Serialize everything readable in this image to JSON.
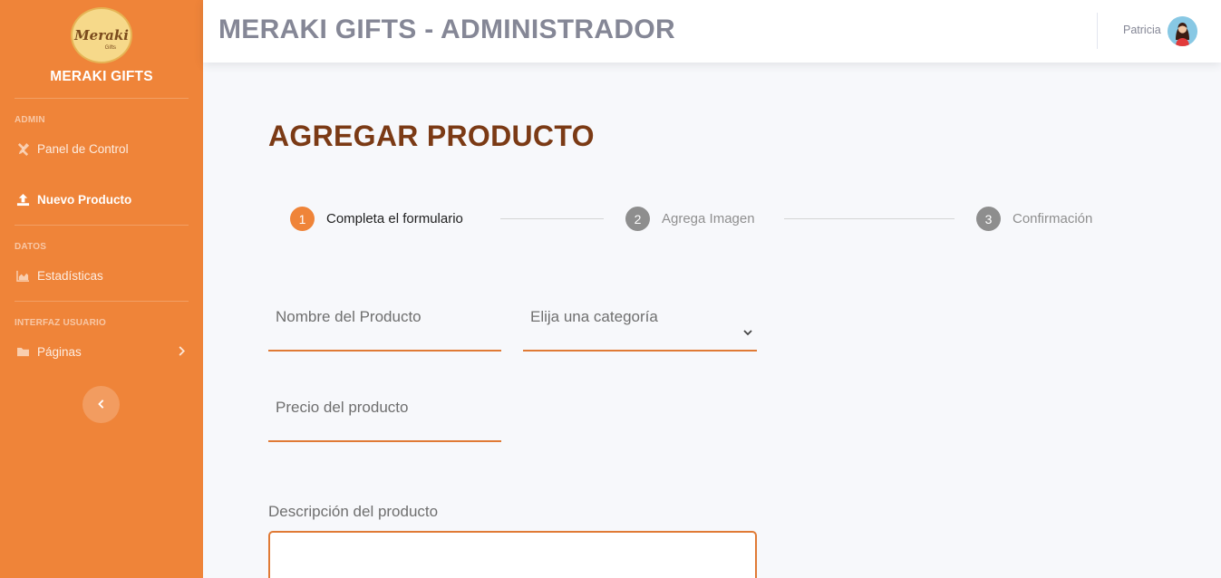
{
  "sidebar": {
    "logo_text": "Meraki",
    "logo_subtext": "Gifts",
    "brand_name": "MERAKI GIFTS",
    "sections": [
      {
        "heading": "ADMIN"
      },
      {
        "heading": "DATOS"
      },
      {
        "heading": "INTERFAZ USUARIO"
      }
    ],
    "items": [
      {
        "label": "Panel de Control",
        "icon": "tools-icon"
      },
      {
        "label": "Nuevo Producto",
        "icon": "upload-icon",
        "active": true
      },
      {
        "label": "Estadísticas",
        "icon": "area-chart-icon"
      },
      {
        "label": "Páginas",
        "icon": "folder-icon"
      }
    ]
  },
  "topbar": {
    "title": "MERAKI GIFTS - ADMINISTRADOR",
    "user_name": "Patricia"
  },
  "main": {
    "page_title": "AGREGAR PRODUCTO",
    "steps": [
      {
        "number": "1",
        "label": "Completa el formulario",
        "state": "active"
      },
      {
        "number": "2",
        "label": "Agrega Imagen",
        "state": "pending"
      },
      {
        "number": "3",
        "label": "Confirmación",
        "state": "pending"
      }
    ],
    "form": {
      "name_placeholder": "Nombre del Producto",
      "category_placeholder": "Elija una categoría",
      "price_placeholder": "Precio del producto",
      "description_label": "Descripción del producto",
      "description_value": ""
    }
  },
  "colors": {
    "sidebar_bg": "#ef8439",
    "accent": "#e07a35",
    "page_title": "#7b3a15",
    "step_pending": "#8e8e8e"
  }
}
